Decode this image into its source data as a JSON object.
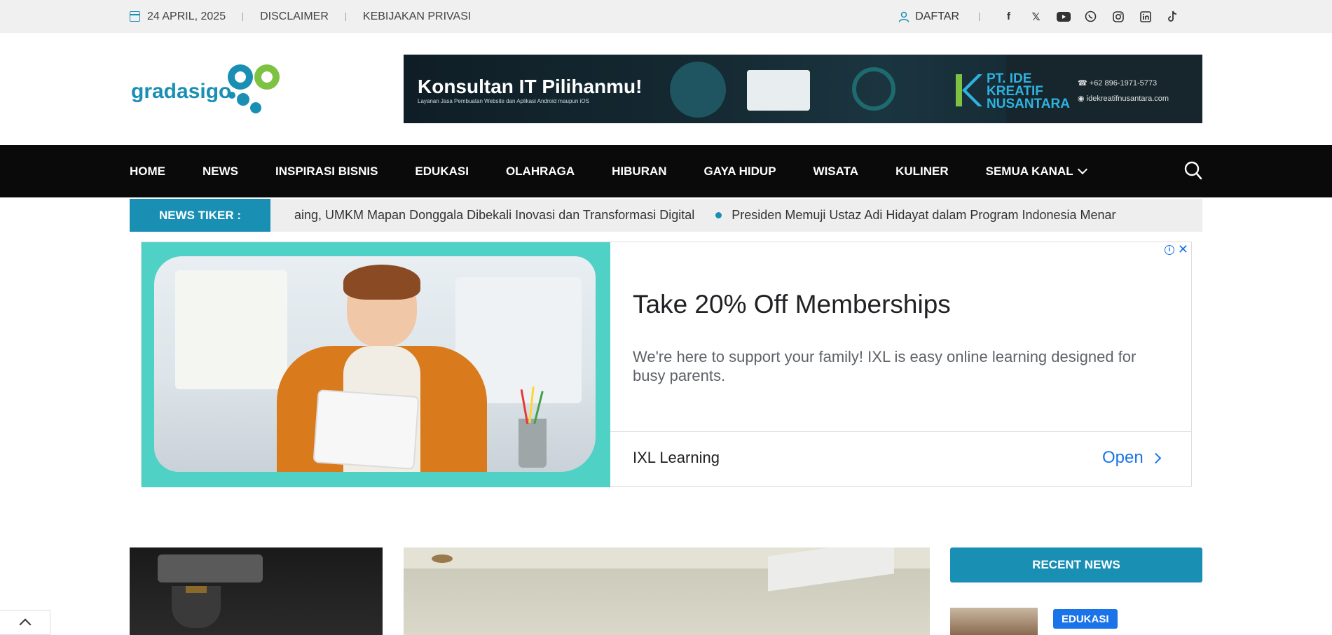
{
  "topbar": {
    "date": "24 APRIL, 2025",
    "links": [
      "DISCLAIMER",
      "KEBIJAKAN PRIVASI"
    ],
    "register": "DAFTAR",
    "social": [
      "facebook-icon",
      "x-icon",
      "youtube-icon",
      "whatsapp-icon",
      "instagram-icon",
      "linkedin-icon",
      "tiktok-icon"
    ]
  },
  "header": {
    "logo_text": "gradasigo",
    "banner": {
      "title": "Konsultan IT Pilihanmu!",
      "subtitle": "Layanan Jasa Pembuatan Website dan Aplikasi Android maupun iOS",
      "company_line1": "PT. IDE",
      "company_line2": "KREATIF",
      "company_line3": "NUSANTARA",
      "phone": "+62 896-1971-5773",
      "website": "idekreatifnusantara.com"
    }
  },
  "nav": {
    "items": [
      "HOME",
      "NEWS",
      "INSPIRASI BISNIS",
      "EDUKASI",
      "OLAHRAGA",
      "HIBURAN",
      "GAYA HIDUP",
      "WISATA",
      "KULINER",
      "SEMUA KANAL"
    ]
  },
  "ticker": {
    "label": "NEWS TIKER :",
    "items": [
      "aing, UMKM Mapan Donggala Dibekali Inovasi dan Transformasi Digital",
      "Presiden Memuji Ustaz Adi Hidayat dalam Program Indonesia Menar"
    ]
  },
  "ad": {
    "title": "Take 20% Off Memberships",
    "description": "We're here to support your family! IXL is easy online learning designed for busy parents.",
    "advertiser": "IXL Learning",
    "cta": "Open"
  },
  "sidebar": {
    "recent_title": "RECENT NEWS",
    "first_badge": "EDUKASI"
  },
  "colors": {
    "accent": "#1a8fb4",
    "nav_bg": "#0a0a0a",
    "ad_teal": "#4fd1c5",
    "link_blue": "#1a73e8"
  }
}
